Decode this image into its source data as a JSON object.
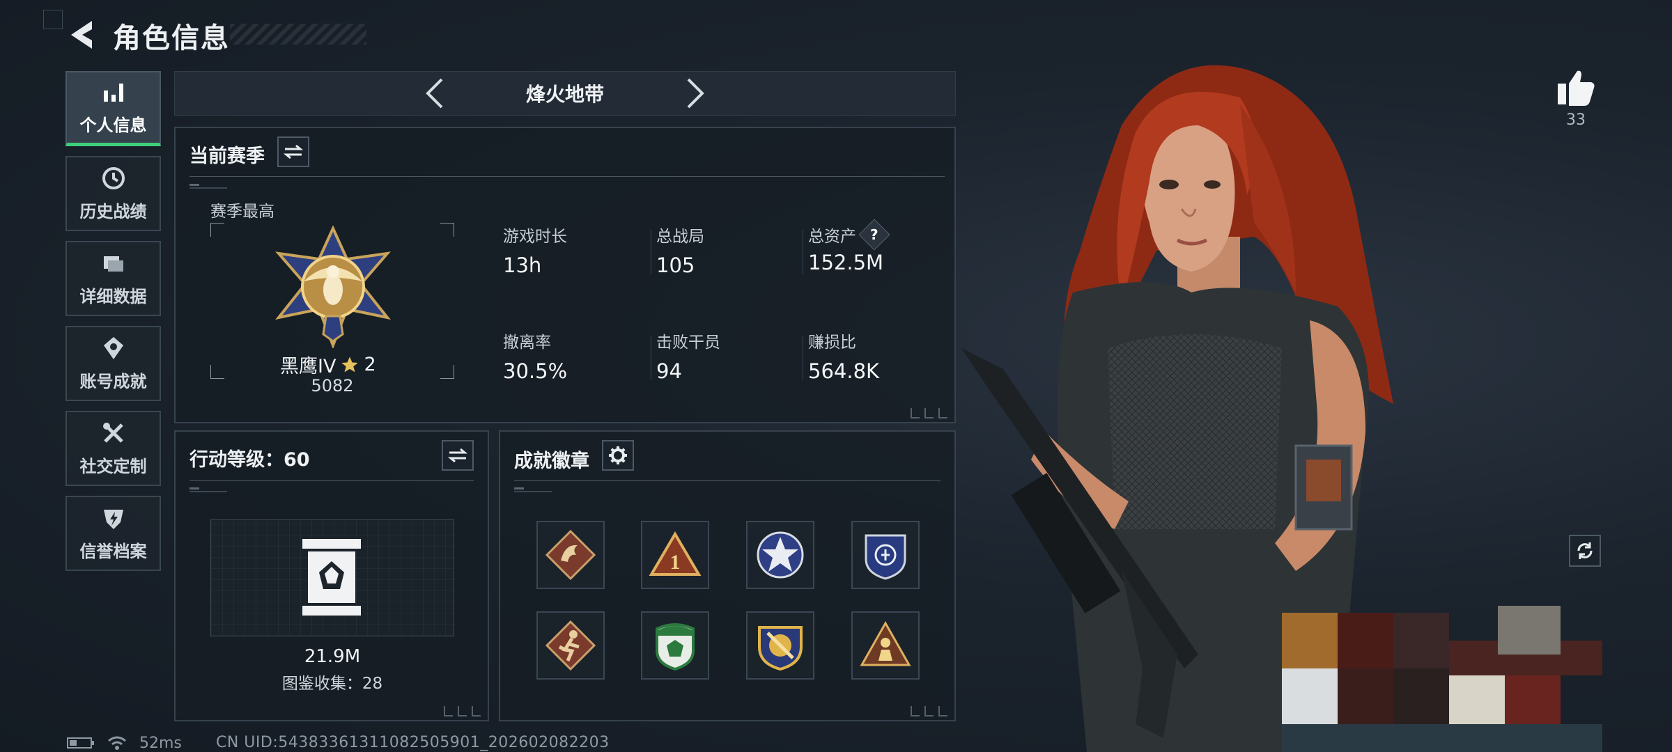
{
  "header": {
    "title": "角色信息",
    "back_icon": "back-arrow-icon"
  },
  "sidebar": {
    "items": [
      {
        "label": "个人信息",
        "icon": "bar-chart-icon",
        "active": true
      },
      {
        "label": "历史战绩",
        "icon": "clock-history-icon",
        "active": false
      },
      {
        "label": "详细数据",
        "icon": "folder-stack-icon",
        "active": false
      },
      {
        "label": "账号成就",
        "icon": "achievement-emblem-icon",
        "active": false
      },
      {
        "label": "社交定制",
        "icon": "tools-icon",
        "active": false
      },
      {
        "label": "信誉档案",
        "icon": "shield-bolt-icon",
        "active": false
      }
    ]
  },
  "mode": {
    "title": "烽火地带"
  },
  "season": {
    "title": "当前赛季",
    "best_label": "赛季最高",
    "rank_name": "黑鹰IV",
    "rank_stars": "2",
    "rank_score": "5082",
    "stats": [
      {
        "label": "游戏时长",
        "value": "13h"
      },
      {
        "label": "总战局",
        "value": "105"
      },
      {
        "label": "总资产",
        "value": "152.5M",
        "help": "?"
      },
      {
        "label": "撤离率",
        "value": "30.5%"
      },
      {
        "label": "击败干员",
        "value": "94"
      },
      {
        "label": "赚损比",
        "value": "564.8K"
      }
    ]
  },
  "action_level": {
    "title": "行动等级：60",
    "value": "21.9M",
    "collection": "图鉴收集：28"
  },
  "achievements": {
    "title": "成就徽章",
    "badges": [
      "dragon-badge-icon",
      "rank-one-triangle-icon",
      "star-circle-badge-icon",
      "shield-emblem-icon",
      "runner-badge-icon",
      "green-shield-badge-icon",
      "gold-crest-badge-icon",
      "soldier-triangle-icon"
    ]
  },
  "social": {
    "likes": "33"
  },
  "status": {
    "ping": "52ms",
    "uid": "CN UID:54383361311082505901_202602082203"
  },
  "colors": {
    "accent_green": "#3ecf7a",
    "panel_border": "#36424d",
    "background": "#1b232d"
  }
}
